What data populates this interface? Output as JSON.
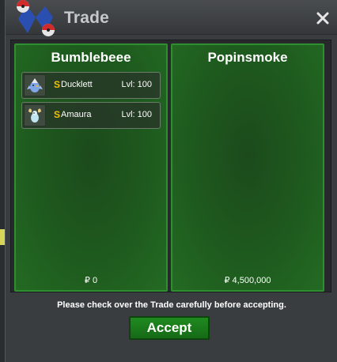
{
  "window": {
    "title": "Trade",
    "close_icon": "close-icon"
  },
  "colors": {
    "panel_green": "#1e5a1e",
    "panel_border": "#2f8e2f",
    "coin_gold": "#f2c200",
    "button_green": "#1f8a1f"
  },
  "trade": {
    "left": {
      "player_name": "Bumblebeee",
      "items": [
        {
          "coin": "S",
          "name": "Ducklett",
          "level": "Lvl: 100",
          "icon": "ducklett-sprite-icon"
        },
        {
          "coin": "S",
          "name": "Amaura",
          "level": "Lvl: 100",
          "icon": "amaura-sprite-icon"
        }
      ],
      "money": "₽ 0"
    },
    "right": {
      "player_name": "Popinsmoke",
      "items": [],
      "money": "₽ 4,500,000"
    }
  },
  "notice": "Please check over the Trade carefully before accepting.",
  "accept_label": "Accept"
}
